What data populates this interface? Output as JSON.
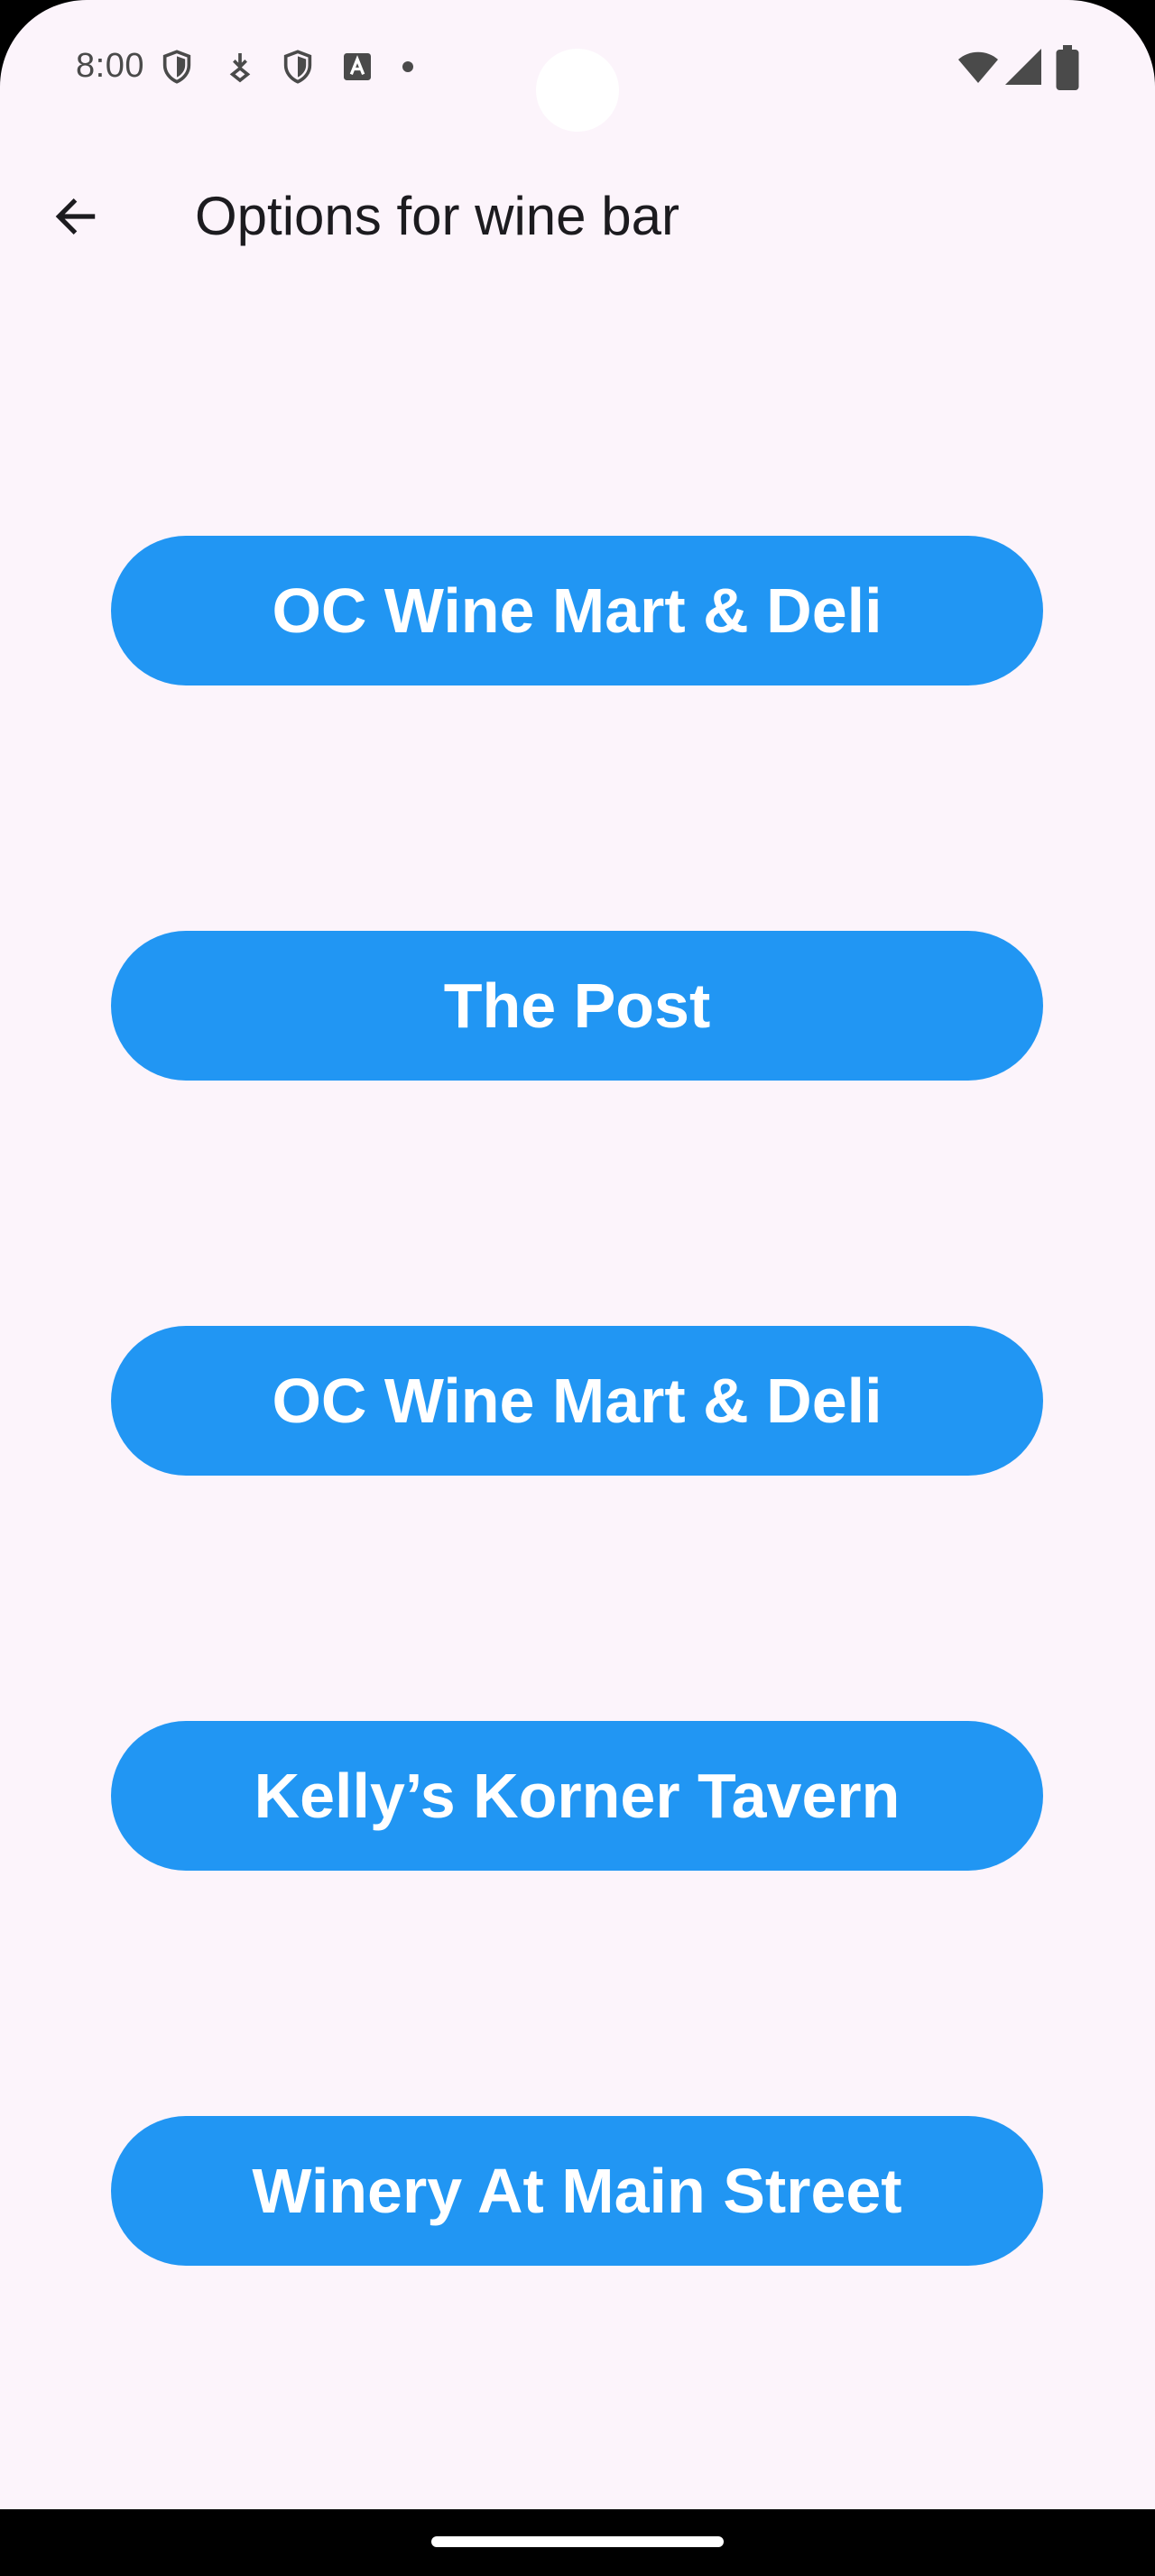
{
  "status_bar": {
    "time": "8:00",
    "left_icons": [
      "shield-icon",
      "download-icon",
      "shield-icon",
      "text-a-icon",
      "dot-icon"
    ],
    "right_icons": [
      "wifi-icon",
      "cellular-signal-icon",
      "battery-icon"
    ]
  },
  "app_bar": {
    "title": "Options for wine bar",
    "back_icon": "arrow-back-icon"
  },
  "options": [
    {
      "label": "OC Wine Mart & Deli"
    },
    {
      "label": "The Post"
    },
    {
      "label": "OC Wine Mart & Deli"
    },
    {
      "label": "Kelly’s Korner Tavern"
    },
    {
      "label": "Winery At Main Street"
    }
  ],
  "colors": {
    "background": "#FCF4FB",
    "button": "#2196F3",
    "button_text": "#FFFFFF",
    "title_text": "#1C1B1F"
  }
}
